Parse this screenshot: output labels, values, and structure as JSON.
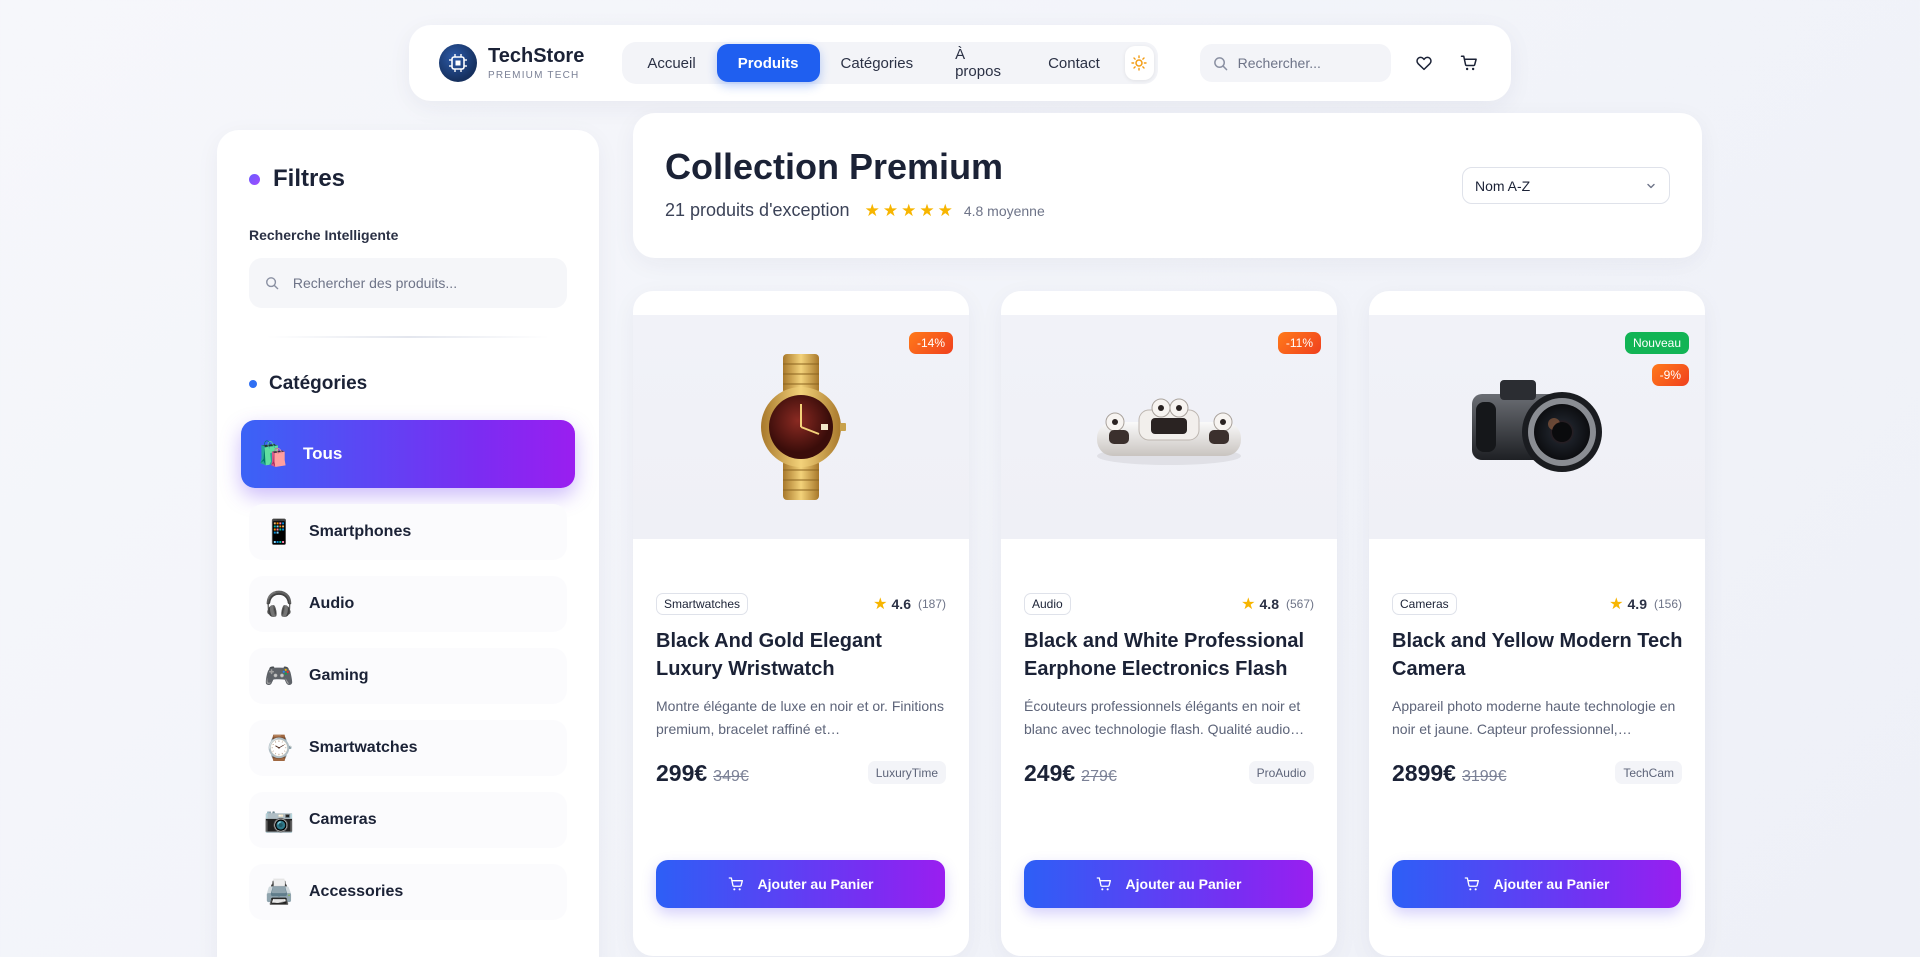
{
  "brand": {
    "name": "TechStore",
    "tagline": "PREMIUM TECH"
  },
  "nav": {
    "items": [
      {
        "label": "Accueil",
        "active": false
      },
      {
        "label": "Produits",
        "active": true
      },
      {
        "label": "Catégories",
        "active": false
      },
      {
        "label": "À propos",
        "active": false
      },
      {
        "label": "Contact",
        "active": false
      }
    ],
    "search_placeholder": "Rechercher..."
  },
  "sidebar": {
    "title": "Filtres",
    "smart_search_label": "Recherche Intelligente",
    "search_placeholder": "Rechercher des produits...",
    "categories_title": "Catégories",
    "categories": [
      {
        "label": "Tous",
        "icon": "🛍️",
        "active": true
      },
      {
        "label": "Smartphones",
        "icon": "📱",
        "active": false
      },
      {
        "label": "Audio",
        "icon": "🎧",
        "active": false
      },
      {
        "label": "Gaming",
        "icon": "🎮",
        "active": false
      },
      {
        "label": "Smartwatches",
        "icon": "⌚",
        "active": false
      },
      {
        "label": "Cameras",
        "icon": "📷",
        "active": false
      },
      {
        "label": "Accessories",
        "icon": "🖨️",
        "active": false
      }
    ]
  },
  "header": {
    "title": "Collection Premium",
    "count": "21 produits d'exception",
    "stars": 5,
    "average": "4.8 moyenne",
    "sort_value": "Nom A-Z"
  },
  "products": [
    {
      "category": "Smartwatches",
      "rating": "4.6",
      "reviews": "(187)",
      "title": "Black And Gold Elegant Luxury Wristwatch",
      "description": "Montre élégante de luxe en noir et or. Finitions premium, bracelet raffiné et…",
      "price": "299€",
      "old_price": "349€",
      "brand": "LuxuryTime",
      "badges": [
        "-14%"
      ],
      "button": "Ajouter au Panier",
      "image": "watch"
    },
    {
      "category": "Audio",
      "rating": "4.8",
      "reviews": "(567)",
      "title": "Black and White Professional Earphone Electronics Flash",
      "description": "Écouteurs professionnels élégants en noir et blanc avec technologie flash. Qualité audio…",
      "price": "249€",
      "old_price": "279€",
      "brand": "ProAudio",
      "badges": [
        "-11%"
      ],
      "button": "Ajouter au Panier",
      "image": "earphones"
    },
    {
      "category": "Cameras",
      "rating": "4.9",
      "reviews": "(156)",
      "title": "Black and Yellow Modern Tech Camera",
      "description": "Appareil photo moderne haute technologie en noir et jaune. Capteur professionnel,…",
      "price": "2899€",
      "old_price": "3199€",
      "brand": "TechCam",
      "badges": [
        "Nouveau",
        "-9%"
      ],
      "button": "Ajouter au Panier",
      "image": "camera"
    }
  ],
  "colors": {
    "primary": "#1f5ff0",
    "gradient_start": "#2d5ff6",
    "gradient_end": "#9a1ef0",
    "star": "#f7b500",
    "discount": "#f0401e",
    "new": "#12b455"
  }
}
